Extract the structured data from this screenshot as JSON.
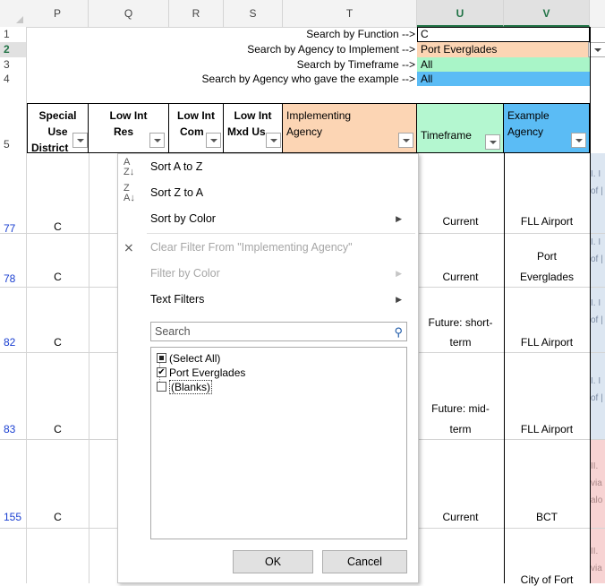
{
  "columns": [
    "P",
    "Q",
    "R",
    "S",
    "T",
    "U",
    "V"
  ],
  "row_numbers": [
    "1",
    "2",
    "3",
    "4",
    "5",
    "77",
    "78",
    "82",
    "83",
    "155"
  ],
  "search_rows": [
    {
      "label": "Search by Function -->",
      "value": "C"
    },
    {
      "label": "Search by Agency to Implement -->",
      "value": "Port Everglades"
    },
    {
      "label": "Search by Timeframe -->",
      "value": "All"
    },
    {
      "label": "Search by Agency who gave the example -->",
      "value": "All"
    }
  ],
  "headers": {
    "P": [
      "Special Use",
      "District"
    ],
    "Q": [
      "Low Int",
      "Res"
    ],
    "R": [
      "Low Int",
      "Com"
    ],
    "S": [
      "Low Int",
      "Mxd Us"
    ],
    "T": [
      "Implementing",
      "Agency"
    ],
    "U": [
      "",
      "Timeframe"
    ],
    "V": [
      "Example",
      "Agency"
    ]
  },
  "rows": [
    {
      "row": "77",
      "P": "C",
      "U": "Current",
      "V": "FLL Airport",
      "W": [
        "I. I",
        "of |"
      ]
    },
    {
      "row": "78",
      "P": "C",
      "U": "Current",
      "V1": "Port",
      "V": "Everglades",
      "W": [
        "I. I",
        "of |"
      ]
    },
    {
      "row": "82",
      "P": "C",
      "U1": "Future: short-",
      "U": "term",
      "V": "FLL Airport",
      "W": [
        "I. I",
        "of |"
      ]
    },
    {
      "row": "83",
      "P": "C",
      "U1": "Future: mid-",
      "U": "term",
      "V": "FLL Airport",
      "W": [
        "I. I",
        "of |"
      ]
    },
    {
      "row": "155",
      "P": "C",
      "U": "Current",
      "V": "BCT",
      "W": [
        "II.",
        "via",
        "alo"
      ]
    },
    {
      "row": "",
      "P": "",
      "U": "",
      "V": "City of Fort",
      "W": [
        "II.",
        "via"
      ]
    }
  ],
  "menu": {
    "items": [
      {
        "label": "Sort A to Z",
        "icon": "sort-az-icon",
        "disabled": false,
        "submenu": false
      },
      {
        "label": "Sort Z to A",
        "icon": "sort-za-icon",
        "disabled": false,
        "submenu": false
      },
      {
        "label": "Sort by Color",
        "icon": "",
        "disabled": false,
        "submenu": true
      },
      {
        "label": "Clear Filter From \"Implementing Agency\"",
        "icon": "clear-filter-icon",
        "disabled": true,
        "submenu": false
      },
      {
        "label": "Filter by Color",
        "icon": "",
        "disabled": true,
        "submenu": true
      },
      {
        "label": "Text Filters",
        "icon": "",
        "disabled": false,
        "submenu": true
      }
    ],
    "search_placeholder": "Search",
    "list": [
      {
        "label": "(Select All)",
        "state": "mixed"
      },
      {
        "label": "Port Everglades",
        "state": "checked"
      },
      {
        "label": "(Blanks)",
        "state": "unchecked"
      }
    ],
    "ok": "OK",
    "cancel": "Cancel"
  },
  "colors": {
    "orange": "#fcd5b4",
    "blue": "#5bbcf5",
    "green": "#a9f5c8",
    "mint": "#b4f7d0",
    "red_hint": "#f7d3d3",
    "blue_hint": "#dce6f1"
  }
}
